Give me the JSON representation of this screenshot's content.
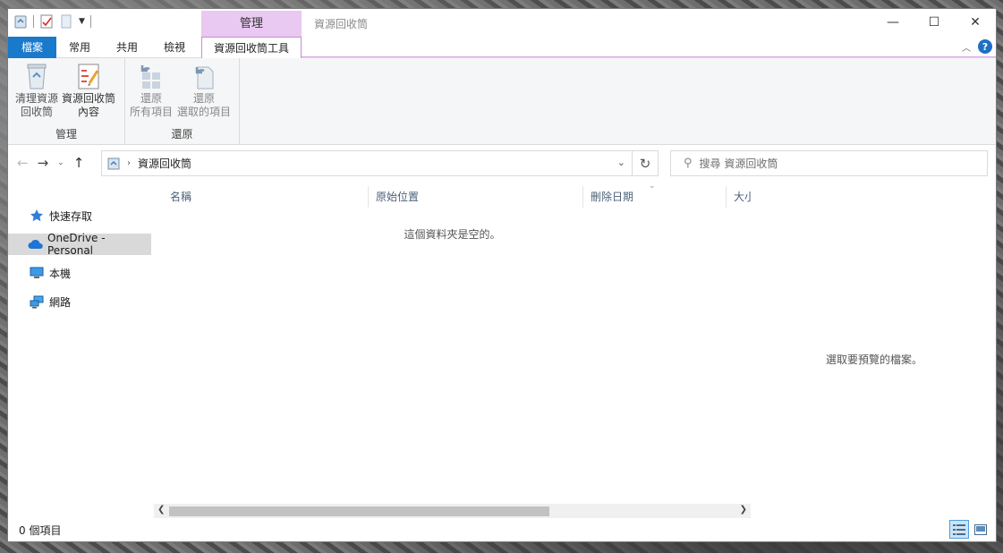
{
  "titlebar": {
    "context_tab": "管理",
    "title": "資源回收筒",
    "minimize": "—",
    "maximize": "☐",
    "close": "✕"
  },
  "tabs": {
    "file": "檔案",
    "home": "常用",
    "share": "共用",
    "view": "檢視",
    "recycle_bin_tools": "資源回收筒工具"
  },
  "ribbon": {
    "manage_group": {
      "label": "管理",
      "empty_bin_line1": "清理資源",
      "empty_bin_line2": "回收筒",
      "properties_line1": "資源回收筒",
      "properties_line2": "內容"
    },
    "restore_group": {
      "label": "還原",
      "restore_all_line1": "還原",
      "restore_all_line2": "所有項目",
      "restore_selected_line1": "還原",
      "restore_selected_line2": "選取的項目"
    },
    "help": "?"
  },
  "address": {
    "path": "資源回收筒",
    "search_placeholder": "搜尋 資源回收筒"
  },
  "navpane": {
    "quick_access": "快速存取",
    "onedrive": "OneDrive - Personal",
    "this_pc": "本機",
    "network": "網路"
  },
  "columns": {
    "name": "名稱",
    "original_location": "原始位置",
    "date_deleted": "刪除日期",
    "size": "大小"
  },
  "file_area": {
    "empty_message": "這個資料夾是空的。"
  },
  "preview": {
    "message": "選取要預覽的檔案。"
  },
  "status": {
    "item_count": "0 個項目"
  },
  "colors": {
    "file_tab": "#1979ca",
    "context_tab": "#e9c8f1",
    "selected_nav": "#d9d9d9"
  }
}
